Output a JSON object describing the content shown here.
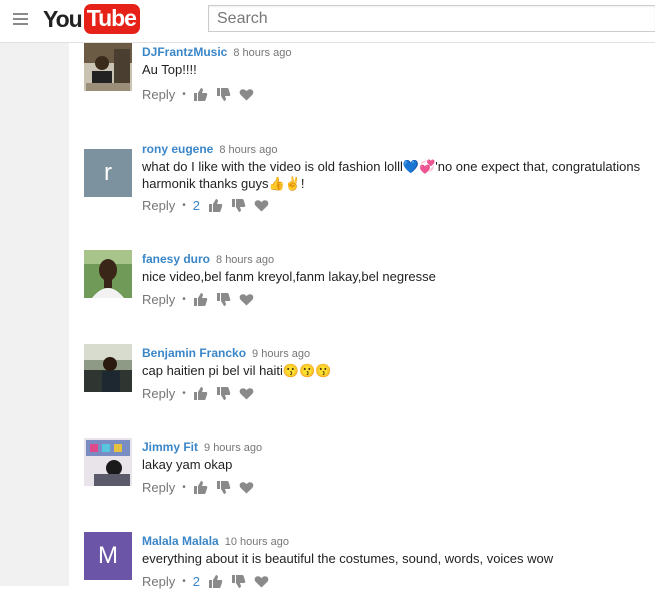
{
  "header": {
    "logo_you": "You",
    "logo_tube": "Tube",
    "search_placeholder": "Search"
  },
  "comments": [
    {
      "author": "DJFrantzMusic",
      "time": "8 hours ago",
      "text": "Au Top!!!!",
      "reply": "Reply",
      "likes": "",
      "avatar_letter": "",
      "avatar_color": "#6b5a44"
    },
    {
      "author": "rony eugene",
      "time": "8 hours ago",
      "text": "what do I like with  the video is old fashion lolll💙💞'no one expect that, congratulations harmonik thanks guys👍✌️!",
      "reply": "Reply",
      "likes": "2",
      "avatar_letter": "r",
      "avatar_color": "#7d929f"
    },
    {
      "author": "fanesy duro",
      "time": "8 hours ago",
      "text": "nice video,bel fanm kreyol,fanm lakay,bel negresse",
      "reply": "Reply",
      "likes": "",
      "avatar_letter": "",
      "avatar_color": "#4a6b3a"
    },
    {
      "author": "Benjamin Francko",
      "time": "9 hours ago",
      "text": "cap haitien pi bel vil haiti😗😗😗",
      "reply": "Reply",
      "likes": "",
      "avatar_letter": "",
      "avatar_color": "#3e4a3a"
    },
    {
      "author": "Jimmy Fit",
      "time": "9 hours ago",
      "text": "lakay yam okap",
      "reply": "Reply",
      "likes": "",
      "avatar_letter": "",
      "avatar_color": "#5a6a8a"
    },
    {
      "author": "Malala Malala",
      "time": "10 hours ago",
      "text": "everything about it is beautiful the costumes, sound, words, voices wow",
      "reply": "Reply",
      "likes": "2",
      "avatar_letter": "M",
      "avatar_color": "#6a55a7"
    }
  ],
  "icons": {
    "menu": "hamburger-icon",
    "like": "thumbs-up-icon",
    "dislike": "thumbs-down-icon",
    "heart": "heart-icon"
  },
  "colors": {
    "author": "#3a86c8",
    "muted": "#767676",
    "logo_red": "#e62117"
  }
}
